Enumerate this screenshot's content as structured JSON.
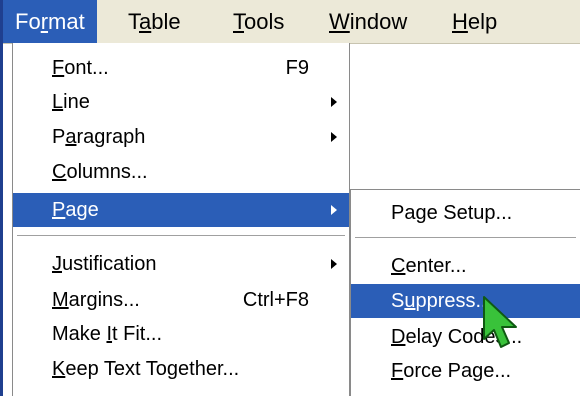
{
  "menubar": {
    "items": [
      {
        "label": "Format",
        "mnemonic_index": 2
      },
      {
        "label": "Table",
        "mnemonic_index": 1
      },
      {
        "label": "Tools",
        "mnemonic_index": 0
      },
      {
        "label": "Window",
        "mnemonic_index": 0
      },
      {
        "label": "Help",
        "mnemonic_index": 0
      }
    ]
  },
  "format_menu": {
    "items": [
      {
        "label": "Font...",
        "mnemonic_index": 0,
        "shortcut": "F9"
      },
      {
        "label": "Line",
        "mnemonic_index": 0
      },
      {
        "label": "Paragraph",
        "mnemonic_index": 1
      },
      {
        "label": "Columns...",
        "mnemonic_index": 0
      },
      {
        "label": "Page",
        "mnemonic_index": 0
      },
      {
        "label": "Justification",
        "mnemonic_index": 0
      },
      {
        "label": "Margins...",
        "mnemonic_index": 0,
        "shortcut": "Ctrl+F8"
      },
      {
        "label": "Make It Fit...",
        "mnemonic_index": 5
      },
      {
        "label": "Keep Text Together...",
        "mnemonic_index": 0
      }
    ]
  },
  "page_submenu": {
    "items": [
      {
        "label": "Page Setup...",
        "mnemonic_index": -1
      },
      {
        "label": "Center...",
        "mnemonic_index": 0
      },
      {
        "label": "Suppress...",
        "mnemonic_index": 1
      },
      {
        "label": "Delay Codes...",
        "mnemonic_index": 0
      },
      {
        "label": "Force Page...",
        "mnemonic_index": 0
      }
    ]
  },
  "colors": {
    "highlight": "#2b5eb7",
    "menubar_bg": "#ece9d8",
    "cursor_fill": "#39c23a"
  },
  "cursor": {
    "icon": "arrow-pointer-icon"
  }
}
